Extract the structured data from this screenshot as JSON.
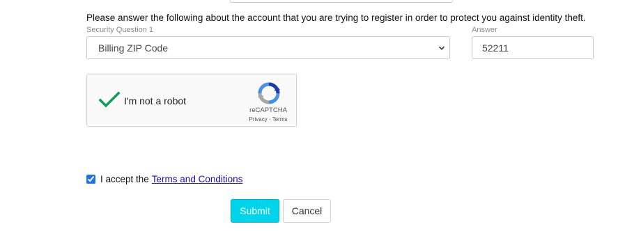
{
  "form": {
    "intro_text": "Please answer the following about the account that you are trying to register in order to protect you against identity theft.",
    "security_question_label": "Security Question 1",
    "security_question_value": "Billing ZIP Code",
    "answer_label": "Answer",
    "answer_value": "52211"
  },
  "captcha": {
    "label": "I'm not a robot",
    "brand": "reCAPTCHA",
    "privacy": "Privacy",
    "separator": " - ",
    "terms": "Terms",
    "checked": true,
    "check_color": "#0f9d58"
  },
  "agreement": {
    "prefix": "I accept the",
    "link": "Terms and Conditions",
    "checked": true
  },
  "buttons": {
    "submit": "Submit",
    "cancel": "Cancel"
  },
  "colors": {
    "submit_bg": "#00d4ea",
    "link": "#1a0dab"
  }
}
